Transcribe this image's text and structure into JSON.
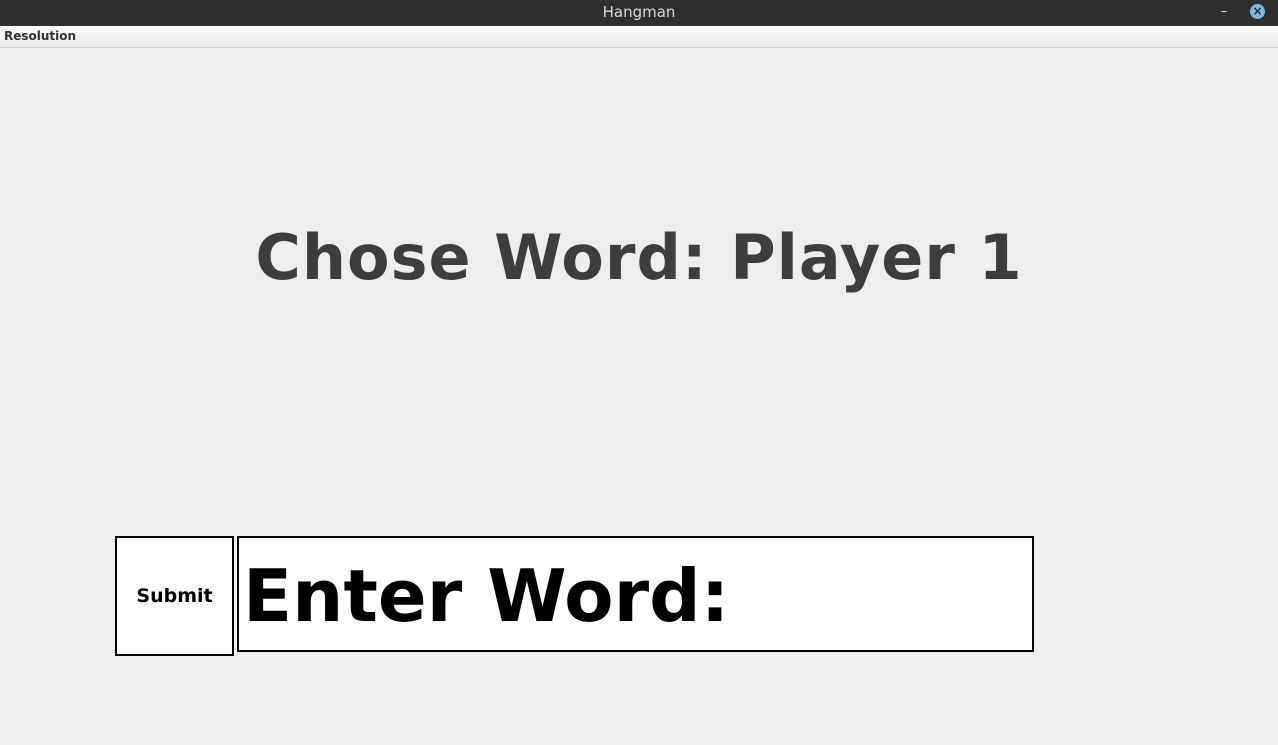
{
  "window": {
    "title": "Hangman",
    "minimize_glyph": "–",
    "close_glyph": "×",
    "close_color": "#7fb6dc"
  },
  "menubar": {
    "items": [
      "Resolution"
    ]
  },
  "main": {
    "heading": "Chose Word: Player 1",
    "submit_label": "Submit",
    "word_input_text": "Enter Word:"
  }
}
